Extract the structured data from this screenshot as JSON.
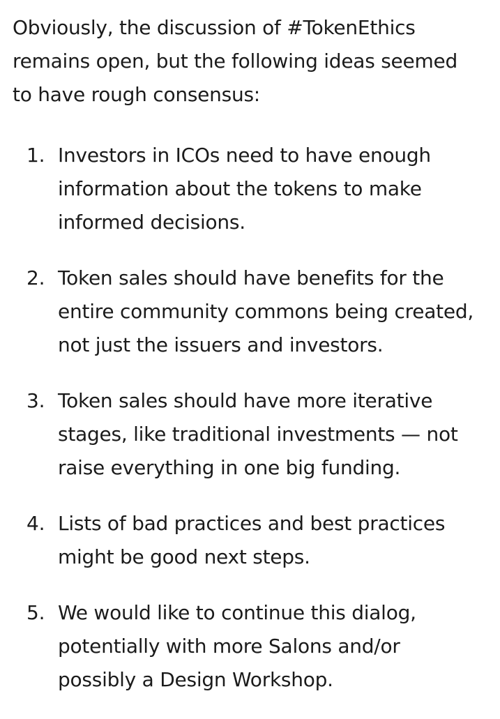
{
  "intro": {
    "lines": [
      "Obviously, the discussion of #TokenEthics",
      "remains open, but the following ideas seemed",
      "to have rough consensus:"
    ]
  },
  "items": [
    {
      "number": "1.",
      "lines": [
        "Investors in ICOs need to have enough",
        "information about the tokens to make",
        "informed decisions."
      ]
    },
    {
      "number": "2.",
      "lines": [
        "Token sales should have benefits for the",
        "entire community commons being created,",
        "not just the issuers and investors."
      ]
    },
    {
      "number": "3.",
      "lines": [
        "Token sales should have more iterative",
        "stages, like traditional investments — not",
        "raise everything in one big funding."
      ]
    },
    {
      "number": "4.",
      "lines": [
        "Lists of bad practices and best practices",
        "might be good next steps."
      ]
    },
    {
      "number": "5.",
      "lines": [
        "We would like to continue this dialog,",
        "potentially with more Salons and/or",
        "possibly a Design Workshop."
      ]
    }
  ]
}
